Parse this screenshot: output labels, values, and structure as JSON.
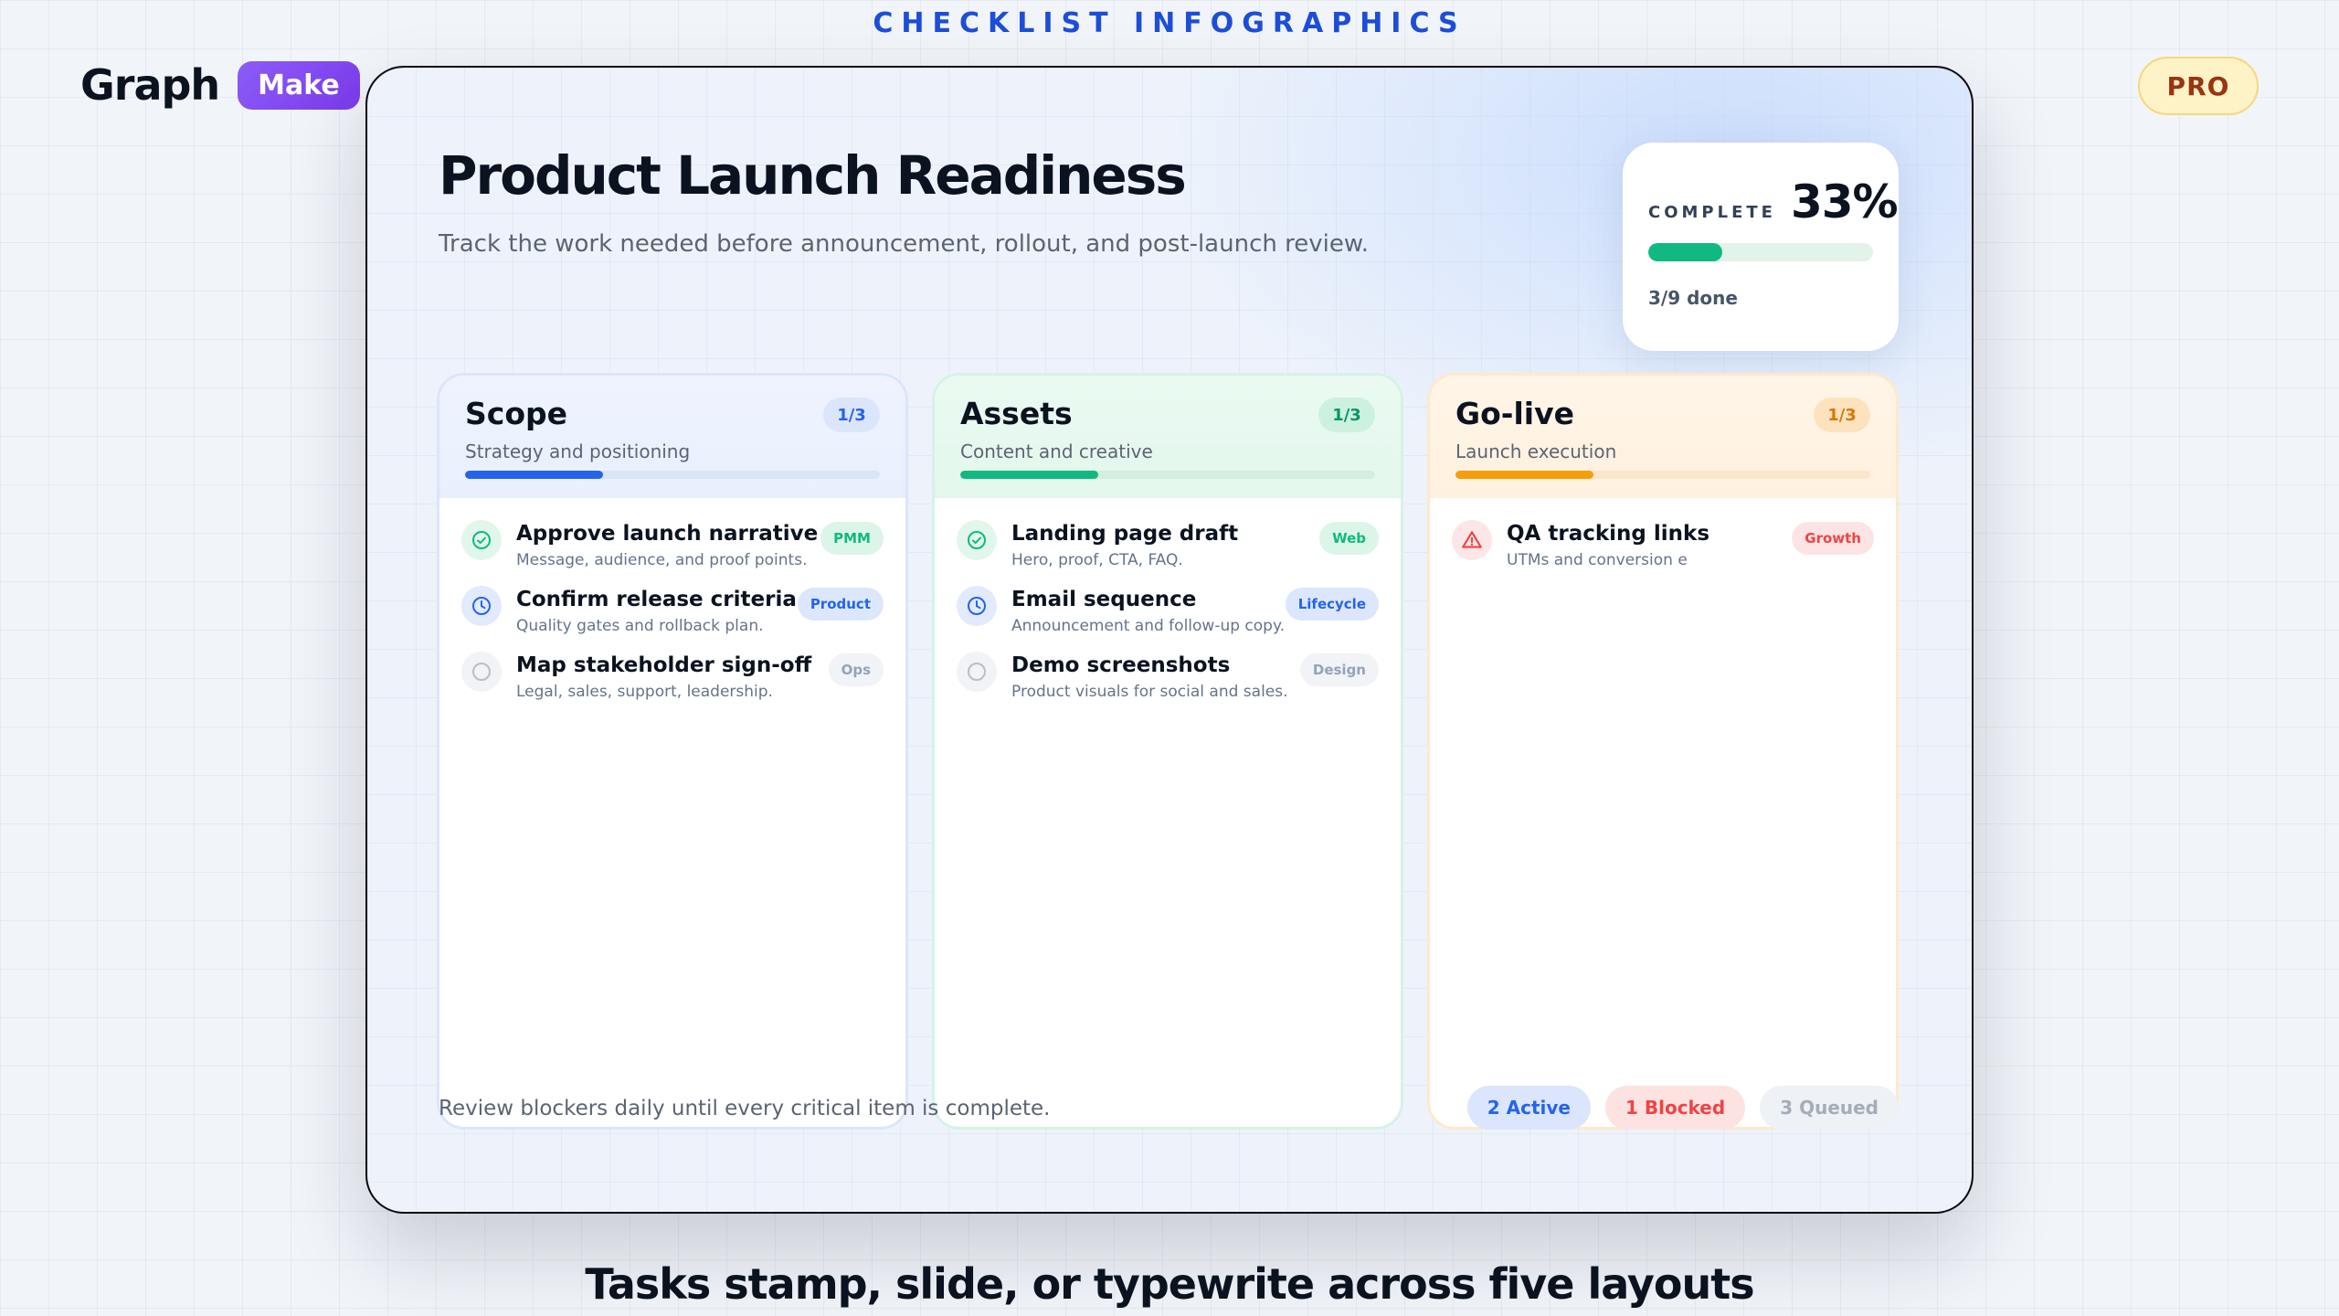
{
  "header": {
    "title": "CHECKLIST INFOGRAPHICS"
  },
  "brand": {
    "name": "Graph",
    "badge": "Make"
  },
  "plan_badge": "PRO",
  "board": {
    "title": "Product Launch Readiness",
    "subtitle": "Track the work needed before announcement, rollout, and post-launch review.",
    "progress": {
      "label": "COMPLETE",
      "percent_text": "33%",
      "fraction": 0.33,
      "done_text": "3/9 done"
    },
    "columns": [
      {
        "title": "Scope",
        "subtitle": "Strategy and positioning",
        "count": "1/3",
        "progress": 0.333,
        "tasks": [
          {
            "status": "done",
            "icon": "check-circle-icon",
            "title": "Approve launch narrative",
            "desc": "Message, audience, and proof points.",
            "tag": "PMM"
          },
          {
            "status": "active",
            "icon": "clock-icon",
            "title": "Confirm release criteria",
            "desc": "Quality gates and rollback plan.",
            "tag": "Product"
          },
          {
            "status": "queued",
            "icon": "empty-circle-icon",
            "title": "Map stakeholder sign-off",
            "desc": "Legal, sales, support, leadership.",
            "tag": "Ops"
          }
        ]
      },
      {
        "title": "Assets",
        "subtitle": "Content and creative",
        "count": "1/3",
        "progress": 0.333,
        "tasks": [
          {
            "status": "done",
            "icon": "check-circle-icon",
            "title": "Landing page draft",
            "desc": "Hero, proof, CTA, FAQ.",
            "tag": "Web"
          },
          {
            "status": "active",
            "icon": "clock-icon",
            "title": "Email sequence",
            "desc": "Announcement and follow-up copy.",
            "tag": "Lifecycle"
          },
          {
            "status": "queued",
            "icon": "empty-circle-icon",
            "title": "Demo screenshots",
            "desc": "Product visuals for social and sales.",
            "tag": "Design"
          }
        ]
      },
      {
        "title": "Go-live",
        "subtitle": "Launch execution",
        "count": "1/3",
        "progress": 0.333,
        "tasks": [
          {
            "status": "blocked",
            "icon": "warning-triangle-icon",
            "title": "QA tracking links",
            "desc": "UTMs and conversion e",
            "tag": "Growth"
          }
        ]
      }
    ],
    "footer_note": "Review blockers daily until every critical item is complete.",
    "status_pills": {
      "active": "2 Active",
      "blocked": "1 Blocked",
      "queued": "3 Queued"
    }
  },
  "caption": "Tasks stamp, slide, or typewrite across five layouts",
  "colors": {
    "accent_blue": "#2563eb",
    "accent_green": "#10b981",
    "accent_amber": "#f59e0b",
    "accent_red": "#ef4444",
    "brand_purple": "#7c3aed"
  }
}
